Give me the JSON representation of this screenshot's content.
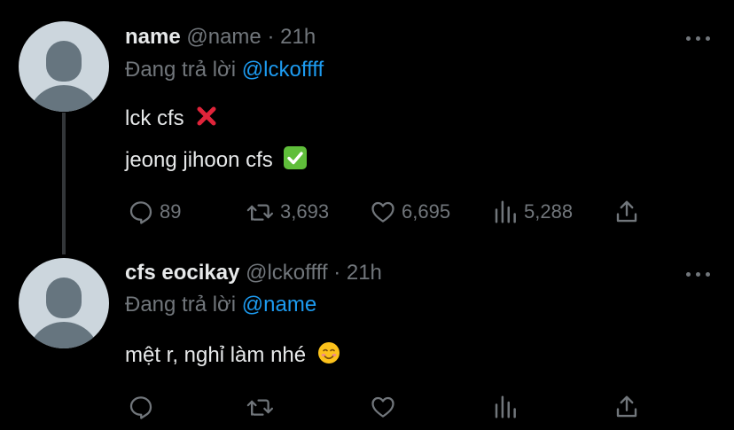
{
  "tweets": [
    {
      "display_name": "name",
      "handle": "@name",
      "separator": "·",
      "time": "21h",
      "replying_prefix": "Đang trả lời",
      "replying_to": "@lckoffff",
      "lines": [
        {
          "text": "lck cfs",
          "emoji": "cross-mark"
        },
        {
          "text": "jeong jihoon cfs",
          "emoji": "check-mark"
        }
      ],
      "stats": {
        "replies": "89",
        "retweets": "3,693",
        "likes": "6,695",
        "views": "5,288"
      }
    },
    {
      "display_name": "cfs eocikay",
      "handle": "@lckoffff",
      "separator": "·",
      "time": "21h",
      "replying_prefix": "Đang trả lời",
      "replying_to": "@name",
      "lines": [
        {
          "text": "mệt r, nghỉ làm nhé",
          "emoji": "smiling-face"
        }
      ],
      "stats": {
        "replies": "",
        "retweets": "",
        "likes": "",
        "views": ""
      }
    }
  ],
  "colors": {
    "background": "#000000",
    "text": "#e7e9ea",
    "muted": "#71767b",
    "link": "#1d9bf0",
    "avatar_bg": "#ccd6dd",
    "avatar_fg": "#66757f"
  }
}
